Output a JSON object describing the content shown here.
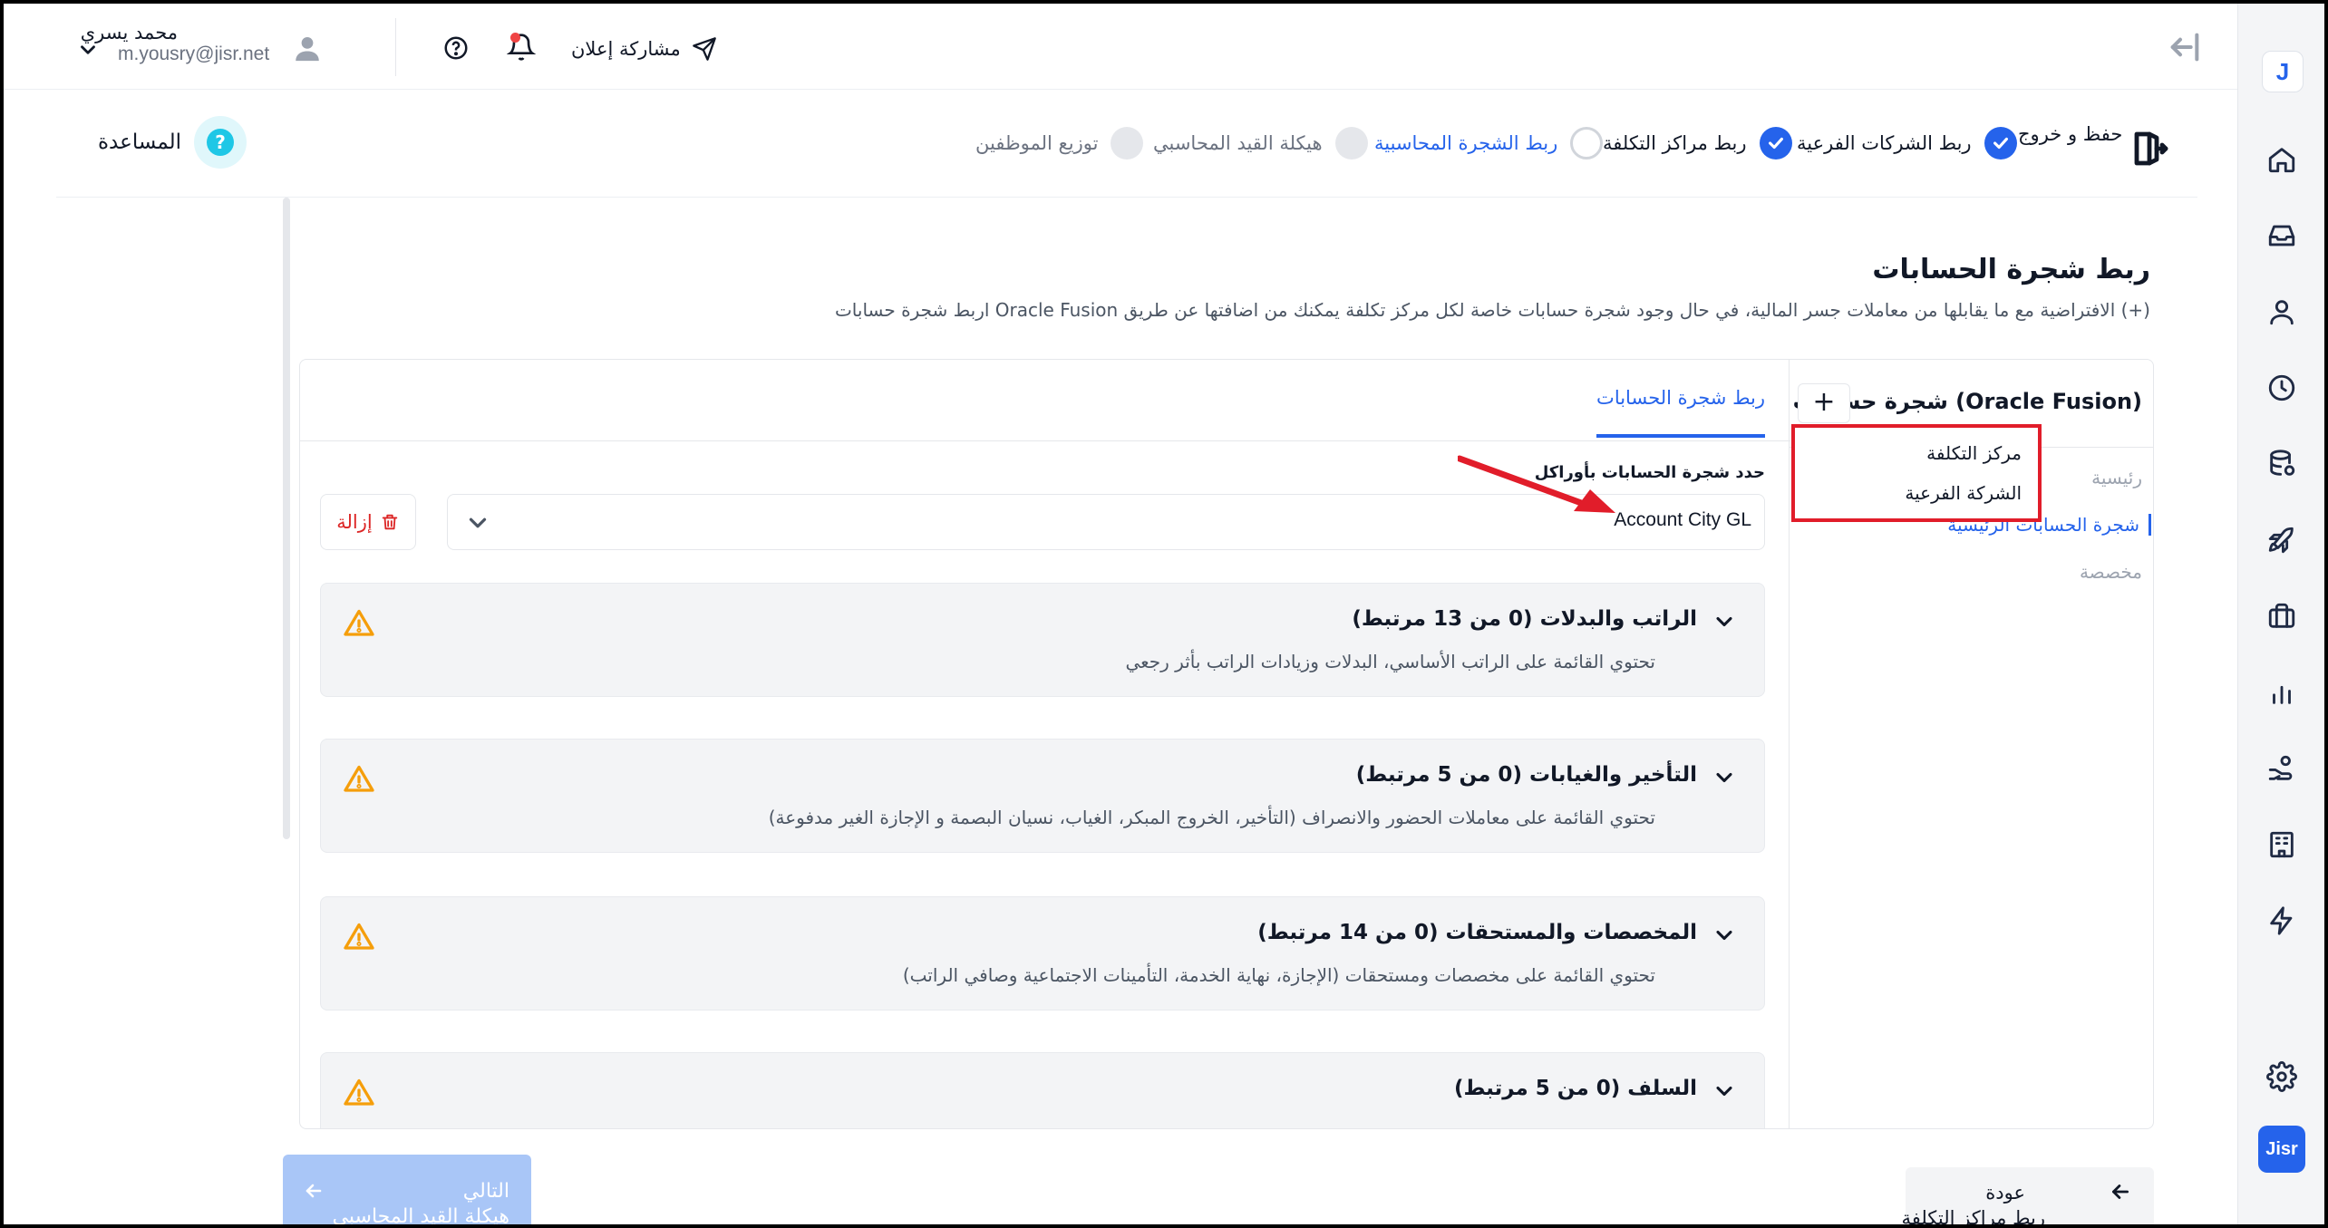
{
  "header": {
    "share_label": "مشاركة إعلان",
    "user_name": "محمد يسري",
    "user_email": "m.yousry@jisr.net"
  },
  "sidebar": {
    "logo_letter": "J",
    "brand_label": "Jisr",
    "icons": [
      "home-icon",
      "inbox-icon",
      "user-icon",
      "clock-icon",
      "database-icon",
      "rocket-icon",
      "briefcase-icon",
      "chart-icon",
      "hand-coin-icon",
      "building-icon",
      "bolt-icon",
      "settings-icon"
    ]
  },
  "stepper": {
    "save_exit_label": "حفظ و خروج",
    "help_label": "المساعدة",
    "help_symbol": "?",
    "steps": [
      {
        "label": "ربط الشركات الفرعية",
        "state": "done"
      },
      {
        "label": "ربط مراكز التكلفة",
        "state": "done"
      },
      {
        "label": "ربط الشجرة المحاسبية",
        "state": "current"
      },
      {
        "label": "هيكلة القيد المحاسبي",
        "state": "todo"
      },
      {
        "label": "توزيع الموظفين",
        "state": "todo"
      }
    ]
  },
  "page": {
    "title": "ربط شجرة الحسابات",
    "subtitle": "اربط شجرة حسابات Oracle Fusion الافتراضية مع ما يقابلها من معاملات جسر المالية، في حال وجود شجرة حسابات خاصة لكل مركز تكلفة يمكنك من اضافتها عن طريق (+)"
  },
  "tree_panel": {
    "title": "شجرة حسابات (Oracle Fusion)",
    "add_symbol": "+",
    "items": [
      {
        "label": "رئيسية",
        "state": "muted"
      },
      {
        "label": "شجرة الحسابات الرئيسية",
        "state": "active"
      },
      {
        "label": "مخصصة",
        "state": "muted"
      }
    ]
  },
  "popup_menu": {
    "items": [
      "مركز التكلفة",
      "الشركة الفرعية"
    ]
  },
  "mapping": {
    "tab_label": "ربط شجرة الحسابات",
    "select_label": "حدد شجرة الحسابات بأوراكل",
    "select_value": "Account City GL",
    "remove_label": "إزالة"
  },
  "accordions": [
    {
      "title": "الراتب والبدلات (0 من 13 مرتبط)",
      "description": "تحتوي القائمة على الراتب الأساسي، البدلات وزيادات الراتب بأثر رجعي"
    },
    {
      "title": "التأخير والغيابات (0 من 5 مرتبط)",
      "description": "تحتوي القائمة على معاملات الحضور والانصراف (التأخير، الخروج المبكر، الغياب، نسيان البصمة و الإجازة الغير مدفوعة)"
    },
    {
      "title": "المخصصات والمستحقات (0 من 14 مرتبط)",
      "description": "تحتوي القائمة على مخصصات ومستحقات (الإجازة، نهاية الخدمة، التأمينات الاجتماعية وصافي الراتب)"
    },
    {
      "title": "السلف (0 من 5 مرتبط)",
      "description": ""
    }
  ],
  "footer": {
    "next_label": "التالي",
    "next_sub": "هيكلة القيد المحاسبي",
    "back_label": "عودة",
    "back_sub": "ربط مراكز التكلفة"
  },
  "colors": {
    "primary": "#2563eb",
    "highlight_red": "#e11d2a",
    "warning": "#f59e0b",
    "danger": "#dc2626"
  }
}
